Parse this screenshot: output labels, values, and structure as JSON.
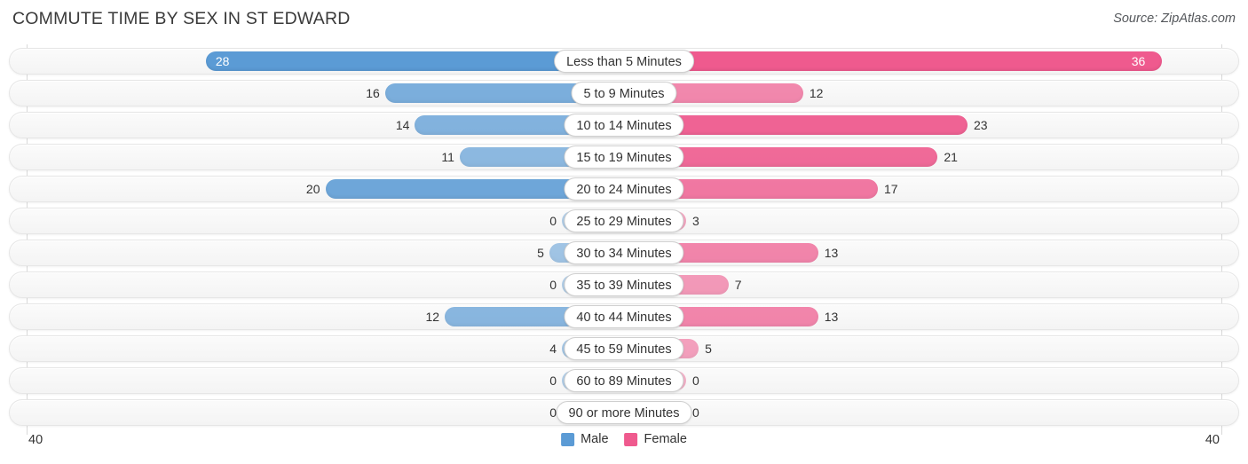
{
  "header": {
    "title": "COMMUTE TIME BY SEX IN ST EDWARD",
    "source": "Source: ZipAtlas.com"
  },
  "axis": {
    "left_max_label": "40",
    "right_max_label": "40"
  },
  "legend": {
    "male_label": "Male",
    "female_label": "Female"
  },
  "colors": {
    "male": "#5b9bd5",
    "female": "#ef5a8e",
    "track": "#f7f7f7",
    "gridline": "#d9d9d9",
    "text": "#333333"
  },
  "chart_data": {
    "type": "bar",
    "subtype": "diverging-horizontal-bar",
    "title": "COMMUTE TIME BY SEX IN ST EDWARD",
    "xlabel": "",
    "ylabel": "",
    "xlim": [
      40,
      40
    ],
    "grid": true,
    "legend_position": "bottom-center",
    "categories": [
      "Less than 5 Minutes",
      "5 to 9 Minutes",
      "10 to 14 Minutes",
      "15 to 19 Minutes",
      "20 to 24 Minutes",
      "25 to 29 Minutes",
      "30 to 34 Minutes",
      "35 to 39 Minutes",
      "40 to 44 Minutes",
      "45 to 59 Minutes",
      "60 to 89 Minutes",
      "90 or more Minutes"
    ],
    "series": [
      {
        "name": "Male",
        "direction": "left",
        "color": "#5b9bd5",
        "values": [
          28,
          16,
          14,
          11,
          20,
          0,
          5,
          0,
          12,
          4,
          0,
          0
        ]
      },
      {
        "name": "Female",
        "direction": "right",
        "color": "#ef5a8e",
        "values": [
          36,
          12,
          23,
          21,
          17,
          3,
          13,
          7,
          13,
          5,
          0,
          0
        ]
      }
    ],
    "rows": [
      {
        "category": "Less than 5 Minutes",
        "male": 28,
        "female": 36,
        "male_label": "28",
        "female_label": "36"
      },
      {
        "category": "5 to 9 Minutes",
        "male": 16,
        "female": 12,
        "male_label": "16",
        "female_label": "12"
      },
      {
        "category": "10 to 14 Minutes",
        "male": 14,
        "female": 23,
        "male_label": "14",
        "female_label": "23"
      },
      {
        "category": "15 to 19 Minutes",
        "male": 11,
        "female": 21,
        "male_label": "11",
        "female_label": "21"
      },
      {
        "category": "20 to 24 Minutes",
        "male": 20,
        "female": 17,
        "male_label": "20",
        "female_label": "17"
      },
      {
        "category": "25 to 29 Minutes",
        "male": 0,
        "female": 3,
        "male_label": "0",
        "female_label": "3"
      },
      {
        "category": "30 to 34 Minutes",
        "male": 5,
        "female": 13,
        "male_label": "5",
        "female_label": "13"
      },
      {
        "category": "35 to 39 Minutes",
        "male": 0,
        "female": 7,
        "male_label": "0",
        "female_label": "7"
      },
      {
        "category": "40 to 44 Minutes",
        "male": 12,
        "female": 13,
        "male_label": "12",
        "female_label": "13"
      },
      {
        "category": "45 to 59 Minutes",
        "male": 4,
        "female": 5,
        "male_label": "4",
        "female_label": "5"
      },
      {
        "category": "60 to 89 Minutes",
        "male": 0,
        "female": 0,
        "male_label": "0",
        "female_label": "0"
      },
      {
        "category": "90 or more Minutes",
        "male": 0,
        "female": 0,
        "male_label": "0",
        "female_label": "0"
      }
    ]
  }
}
